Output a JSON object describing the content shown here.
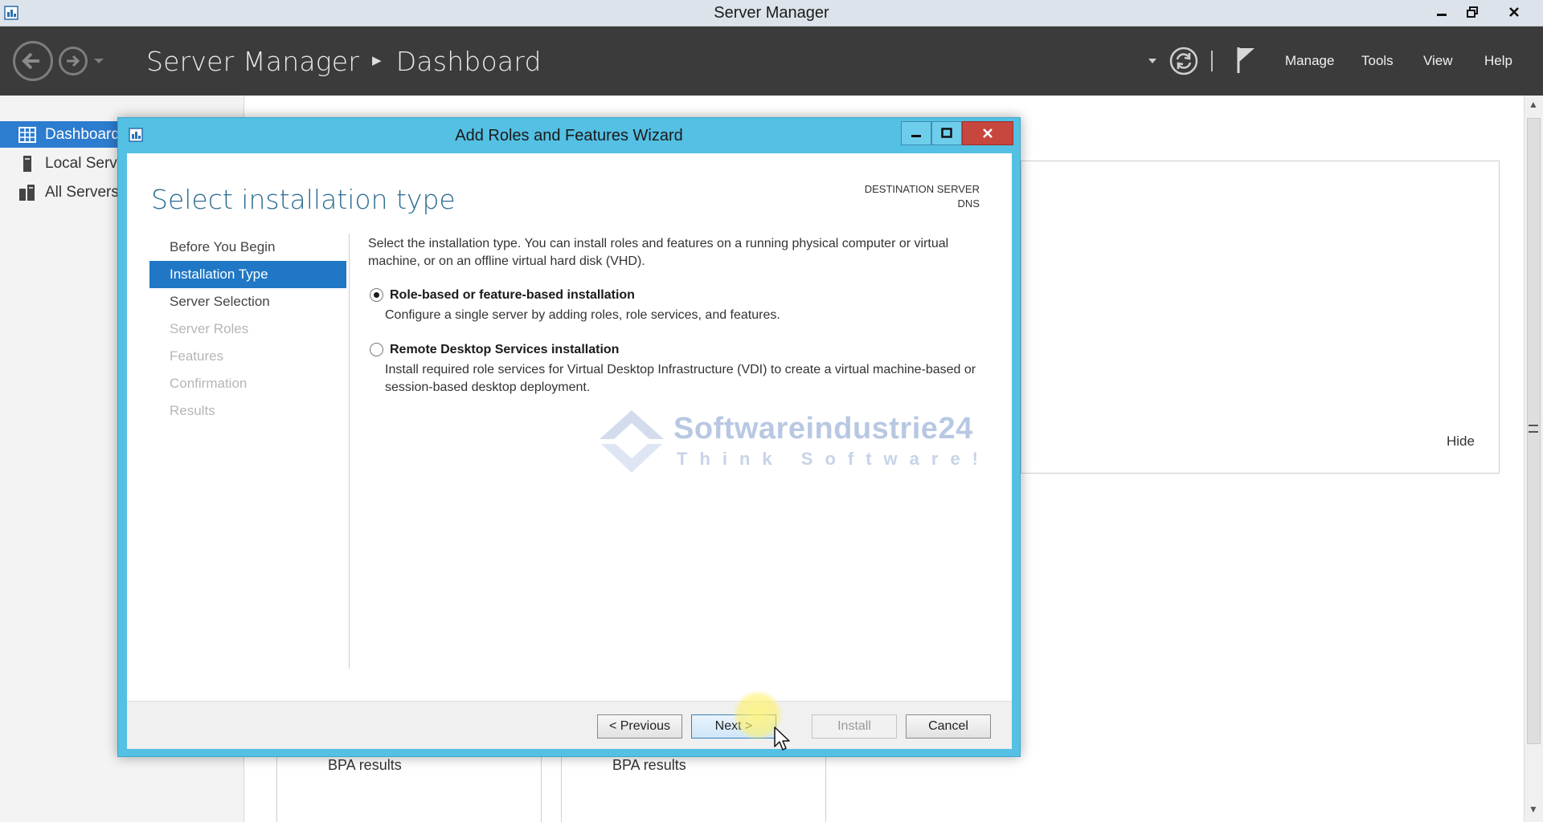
{
  "window": {
    "title": "Server Manager"
  },
  "header": {
    "breadcrumb_root": "Server Manager",
    "breadcrumb_page": "Dashboard",
    "menus": [
      "Manage",
      "Tools",
      "View",
      "Help"
    ]
  },
  "sidebar": {
    "items": [
      {
        "label": "Dashboard",
        "icon": "dashboard-grid-icon",
        "active": true
      },
      {
        "label": "Local Server",
        "icon": "server-icon",
        "active": false
      },
      {
        "label": "All Servers",
        "icon": "servers-icon",
        "active": false
      }
    ]
  },
  "background": {
    "hide_label": "Hide",
    "bpa_label_1": "BPA results",
    "bpa_label_2": "BPA results"
  },
  "wizard": {
    "title": "Add Roles and Features Wizard",
    "heading": "Select installation type",
    "destination_label": "DESTINATION SERVER",
    "destination_value": "DNS",
    "steps": [
      {
        "label": "Before You Begin",
        "state": "normal"
      },
      {
        "label": "Installation Type",
        "state": "active"
      },
      {
        "label": "Server Selection",
        "state": "normal"
      },
      {
        "label": "Server Roles",
        "state": "disabled"
      },
      {
        "label": "Features",
        "state": "disabled"
      },
      {
        "label": "Confirmation",
        "state": "disabled"
      },
      {
        "label": "Results",
        "state": "disabled"
      }
    ],
    "intro": "Select the installation type. You can install roles and features on a running physical computer or virtual machine, or on an offline virtual hard disk (VHD).",
    "options": [
      {
        "title": "Role-based or feature-based installation",
        "desc": "Configure a single server by adding roles, role services, and features.",
        "selected": true
      },
      {
        "title": "Remote Desktop Services installation",
        "desc": "Install required role services for Virtual Desktop Infrastructure (VDI) to create a virtual machine-based or session-based desktop deployment.",
        "selected": false
      }
    ],
    "buttons": {
      "previous": "< Previous",
      "next": "Next >",
      "install": "Install",
      "cancel": "Cancel"
    }
  },
  "watermark": {
    "brand": "Softwareindustrie24",
    "tagline": "Think Software!"
  },
  "colors": {
    "header_bg": "#3b3b3b",
    "nav_active": "#2c7ccf",
    "wizard_frame": "#54c0e4",
    "step_active": "#1f77c6",
    "heading": "#2d6d92"
  }
}
